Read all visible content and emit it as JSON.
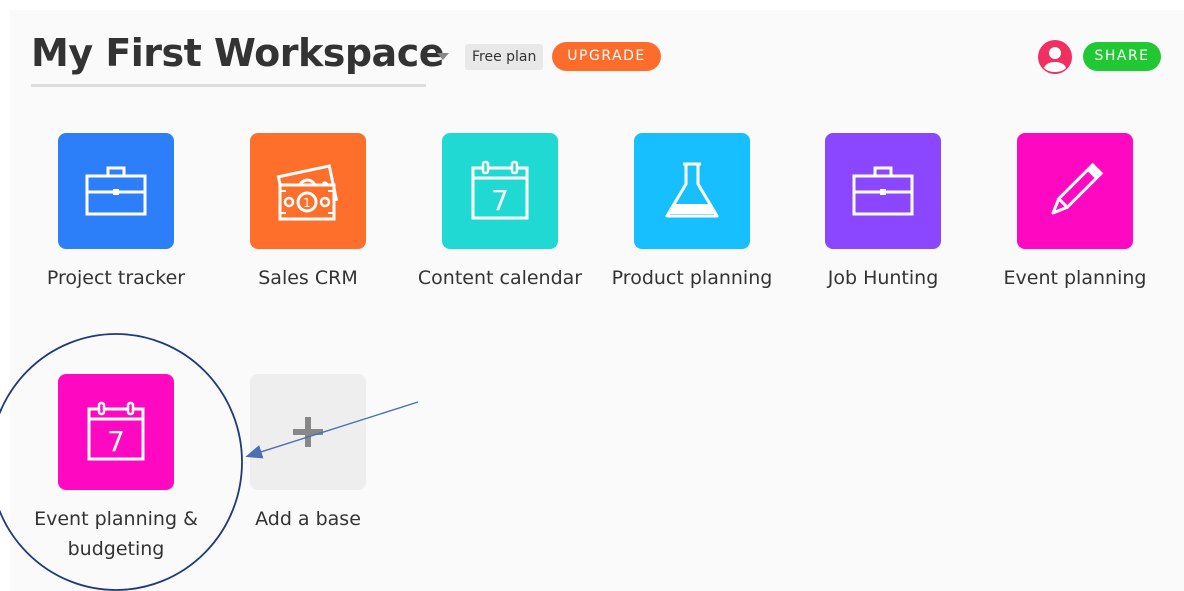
{
  "header": {
    "workspace_title": "My First Workspace",
    "plan_badge": "Free plan",
    "upgrade_label": "UPGRADE",
    "share_label": "SHARE"
  },
  "colors": {
    "upgrade": "#fc6d2c",
    "share": "#20c933",
    "avatar": "#ef3061"
  },
  "bases": [
    {
      "label": "Project tracker",
      "color": "#2d7ff9",
      "icon": "briefcase-icon"
    },
    {
      "label": "Sales CRM",
      "color": "#ff6f2c",
      "icon": "money-icon"
    },
    {
      "label": "Content calendar",
      "color": "#20d9d2",
      "icon": "calendar-icon"
    },
    {
      "label": "Product planning",
      "color": "#18bfff",
      "icon": "flask-icon"
    },
    {
      "label": "Job Hunting",
      "color": "#8b46ff",
      "icon": "briefcase-icon"
    },
    {
      "label": "Event planning",
      "color": "#ff08c2",
      "icon": "pencil-icon"
    }
  ],
  "bases_row2": [
    {
      "label": "Event planning & budgeting",
      "color": "#ff08c2",
      "icon": "calendar-icon"
    }
  ],
  "add_base": {
    "label": "Add a base",
    "icon": "plus-icon"
  },
  "calendar_day": "7"
}
